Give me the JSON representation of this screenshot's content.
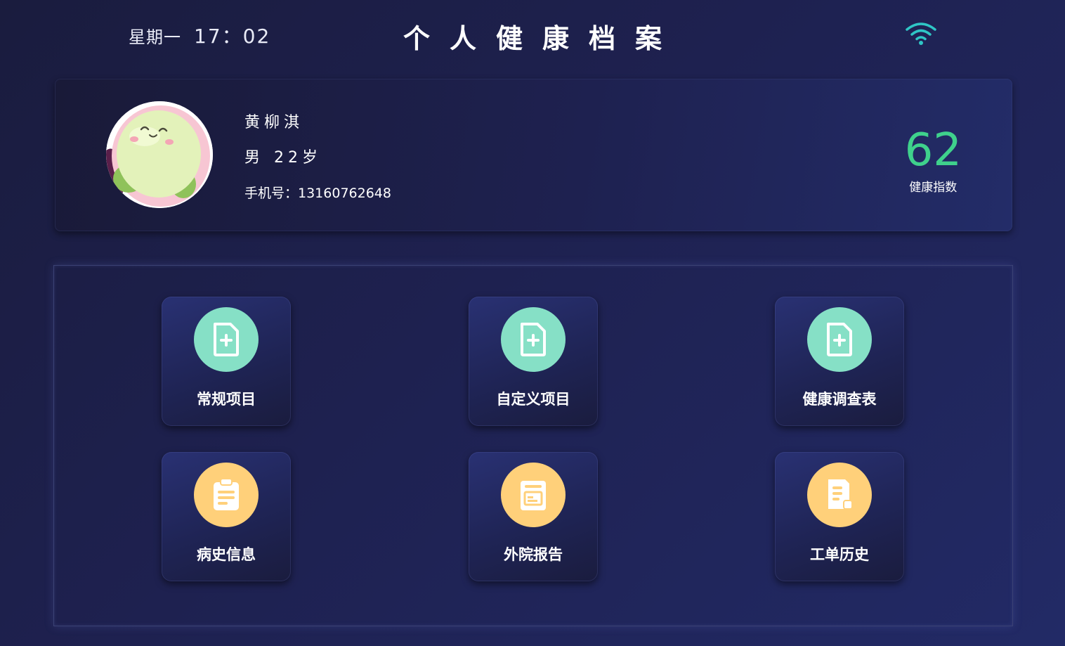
{
  "header": {
    "weekday": "星期一",
    "time": "17：02",
    "title": "个人健康档案"
  },
  "profile": {
    "name": "黄柳淇",
    "gender": "男",
    "age": "22岁",
    "phone": "手机号：13160762648",
    "health_score": "62",
    "health_score_label": "健康指数"
  },
  "menu": {
    "items": [
      {
        "label": "常规项目",
        "icon": "document-plus-icon",
        "color": "#86e0c6"
      },
      {
        "label": "自定义项目",
        "icon": "document-plus-icon",
        "color": "#86e0c6"
      },
      {
        "label": "健康调查表",
        "icon": "document-plus-icon",
        "color": "#86e0c6"
      },
      {
        "label": "病史信息",
        "icon": "clipboard-icon",
        "color": "#ffd07a"
      },
      {
        "label": "外院报告",
        "icon": "report-icon",
        "color": "#ffd07a"
      },
      {
        "label": "工单历史",
        "icon": "work-order-icon",
        "color": "#ffd07a"
      }
    ]
  },
  "colors": {
    "score": "#3fd18c",
    "wifi": "#2fc6c6",
    "green_icon_bg": "#86e0c6",
    "orange_icon_bg": "#ffd07a"
  }
}
